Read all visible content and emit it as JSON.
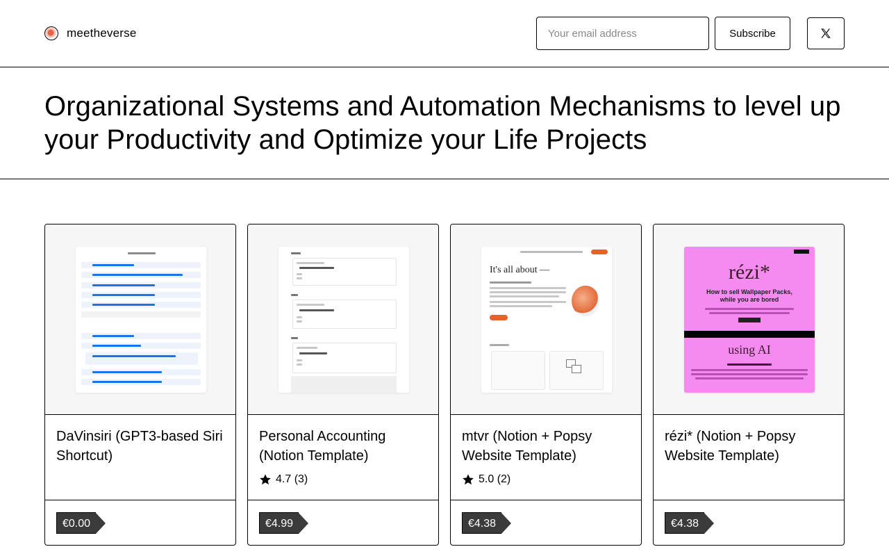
{
  "header": {
    "site_name": "meetheverse",
    "email_placeholder": "Your email address",
    "subscribe_label": "Subscribe",
    "social_icon": "x-twitter-icon"
  },
  "hero": {
    "title": "Organizational Systems and Automation Mechanisms to level up your Productivity and Optimize your Life Projects"
  },
  "products": [
    {
      "title": "DaVinsiri (GPT3-based Siri Shortcut)",
      "rating": null,
      "price": "€0.00",
      "thumb_icon": "shortcut-screenshot-thumbnail"
    },
    {
      "title": "Personal Accounting (Notion Template)",
      "rating": "4.7 (3)",
      "price": "€4.99",
      "thumb_icon": "notion-template-thumbnail"
    },
    {
      "title": "mtvr (Notion + Popsy Website Template)",
      "rating": "5.0 (2)",
      "price": "€4.38",
      "thumb_icon": "website-template-thumbnail"
    },
    {
      "title": "rézi* (Notion + Popsy Website Template)",
      "rating": null,
      "price": "€4.38",
      "thumb_icon": "pink-website-template-thumbnail"
    }
  ],
  "thumb_text": {
    "rezi_brand": "rézi*",
    "rezi_headline": "How to sell Wallpaper Packs,\nwhile you are bored",
    "rezi_using": "using AI",
    "mtvr_heading": "It's all about —"
  },
  "colors": {
    "price_tag_bg": "#3b3b3b",
    "rezi_pink": "#f58af0",
    "mtvr_accent": "#e8602c",
    "shortcut_blue": "#1a73e8"
  }
}
